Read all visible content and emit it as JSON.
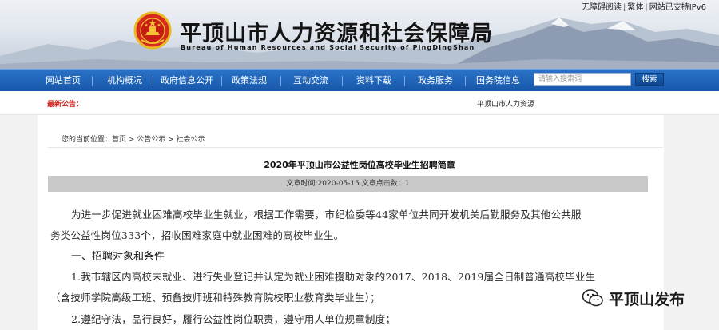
{
  "top_links": {
    "accessible": "无障碍阅读",
    "traditional": "繁体",
    "ipv6": "网站已支持IPv6",
    "sep": "|"
  },
  "site": {
    "title": "平顶山市人力资源和社会保障局",
    "subtitle": "Bureau of Human Resources and Social Security of PingDingShan"
  },
  "nav": {
    "items": [
      {
        "label": "网站首页"
      },
      {
        "label": "机构概况"
      },
      {
        "label": "政府信息公开"
      },
      {
        "label": "政策法规"
      },
      {
        "label": "互动交流"
      },
      {
        "label": "资料下载"
      },
      {
        "label": "政务服务"
      },
      {
        "label": "国务院信息"
      }
    ],
    "search_placeholder": "请输入搜索词",
    "search_button": "搜索"
  },
  "notice": {
    "label": "最新公告：",
    "message": "平顶山市人力资源"
  },
  "breadcrumb": "您的当前位置：首页 > 公告公示 > 社会公示",
  "article": {
    "title": "2020年平顶山市公益性岗位高校毕业生招聘简章",
    "meta": "文章时间:2020-05-15 文章点击数：1",
    "p1_line1": "为进一步促进就业困难高校毕业生就业，根据工作需要，市纪检委等44家单位共同开发机关后勤服务及其他公共服",
    "p1_line2": "务类公益性岗位333个，招收困难家庭中就业困难的高校毕业生。",
    "section1": "一、招聘对象和条件",
    "item1_line1": "1.我市辖区内高校未就业、进行失业登记并认定为就业困难援助对象的2017、2018、2019届全日制普通高校毕业生",
    "item1_line2": "（含技师学院高级工班、预备技师班和特殊教育院校职业教育类毕业生）；",
    "item2_line1": "2.遵纪守法，品行良好，履行公益性岗位职责，遵守用人单位规章制度；"
  },
  "watermark": {
    "text": "平顶山发布"
  },
  "colors": {
    "nav_blue": "#1f64b8",
    "notice_red": "#d4201a",
    "meta_gray": "#c8c8c8"
  }
}
